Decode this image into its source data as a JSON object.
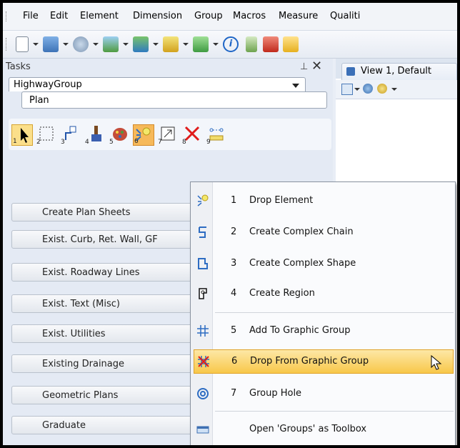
{
  "menubar": {
    "items": [
      "File",
      "Edit",
      "Element",
      "Dimension",
      "Group",
      "Macros",
      "Measure",
      "Qualiti"
    ]
  },
  "toolbar": {
    "icons": [
      "new-file-icon",
      "models-icon",
      "level-icon",
      "view-attributes-icon",
      "reference-icon",
      "layers-icon",
      "settings-icon",
      "info-icon",
      "select-icon",
      "edit-icon",
      "folder-icon"
    ]
  },
  "tasks": {
    "title": "Tasks",
    "pin": "⊥",
    "close": "✕",
    "combo_value": "HighwayGroup",
    "plan_label": "Plan",
    "tools": [
      {
        "icon": "select-arrow-icon",
        "num": "1"
      },
      {
        "icon": "selection-box-icon",
        "num": "2"
      },
      {
        "icon": "move-icon",
        "num": "3"
      },
      {
        "icon": "brush-icon",
        "num": "4"
      },
      {
        "icon": "palette-icon",
        "num": "5"
      },
      {
        "icon": "drop-element-icon",
        "num": "6"
      },
      {
        "icon": "scale-icon",
        "num": "7"
      },
      {
        "icon": "delete-icon",
        "num": "8"
      },
      {
        "icon": "measure-icon",
        "num": "9"
      }
    ],
    "list": [
      "Create Plan Sheets",
      "Exist. Curb, Ret. Wall, GF",
      "Exist. Roadway Lines",
      "Exist. Text (Misc)",
      "Exist. Utilities",
      "Existing Drainage",
      "Geometric Plans",
      "Graduate"
    ]
  },
  "view": {
    "tab_label": "View 1, Default"
  },
  "context_menu": {
    "items": [
      {
        "num": "1",
        "label": "Drop Element",
        "icon": "drop-element-icon"
      },
      {
        "num": "2",
        "label": "Create Complex Chain",
        "icon": "complex-chain-icon"
      },
      {
        "num": "3",
        "label": "Create Complex Shape",
        "icon": "complex-shape-icon"
      },
      {
        "num": "4",
        "label": "Create Region",
        "icon": "region-icon"
      },
      {
        "num": "5",
        "label": "Add To Graphic Group",
        "icon": "add-group-icon"
      },
      {
        "num": "6",
        "label": "Drop From Graphic Group",
        "icon": "drop-group-icon"
      },
      {
        "num": "7",
        "label": "Group Hole",
        "icon": "group-hole-icon"
      },
      {
        "num": "",
        "label": "Open 'Groups' as Toolbox",
        "icon": "toolbox-icon"
      }
    ],
    "highlighted_index": 5
  },
  "colors": {
    "highlight_top": "#fde8a6",
    "highlight_bottom": "#f8c84a",
    "panel_bg": "#e4eaf4"
  }
}
